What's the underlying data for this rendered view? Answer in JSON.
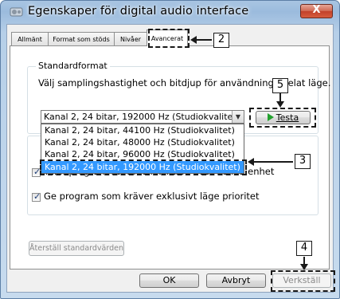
{
  "window": {
    "title": "Egenskaper för digital audio interface",
    "close_symbol": "X"
  },
  "tabs": [
    {
      "label": "Allmänt"
    },
    {
      "label": "Format som stöds"
    },
    {
      "label": "Nivåer"
    },
    {
      "label": "Avancerat"
    }
  ],
  "default_format": {
    "legend": "Standardformat",
    "description": "Välj samplingshastighet och bitdjup för användning i delat läge.",
    "selected": "Kanal 2, 24 bitar, 192000 Hz (Studiokvalitet)",
    "options": [
      "Kanal 2, 24 bitar, 44100 Hz (Studiokvalitet)",
      "Kanal 2, 24 bitar, 48000 Hz (Studiokvalitet)",
      "Kanal 2, 24 bitar, 96000 Hz (Studiokvalitet)",
      "Kanal 2, 24 bitar, 192000 Hz (Studiokvalitet)"
    ],
    "test_label": "Testa"
  },
  "exclusive": {
    "allow_label": "Tillåt program att ta full kontroll över denna enhet",
    "priority_label": "Ge program som kräver exklusivt läge prioritet"
  },
  "buttons": {
    "restore": "Återställ standardvärden",
    "ok": "OK",
    "cancel": "Avbryt",
    "apply": "Verkställ"
  },
  "callouts": {
    "c2": "2",
    "c3": "3",
    "c4": "4",
    "c5": "5"
  },
  "colors": {
    "selection": "#3399ff",
    "play": "#23a12e",
    "close": "#c2412a"
  }
}
